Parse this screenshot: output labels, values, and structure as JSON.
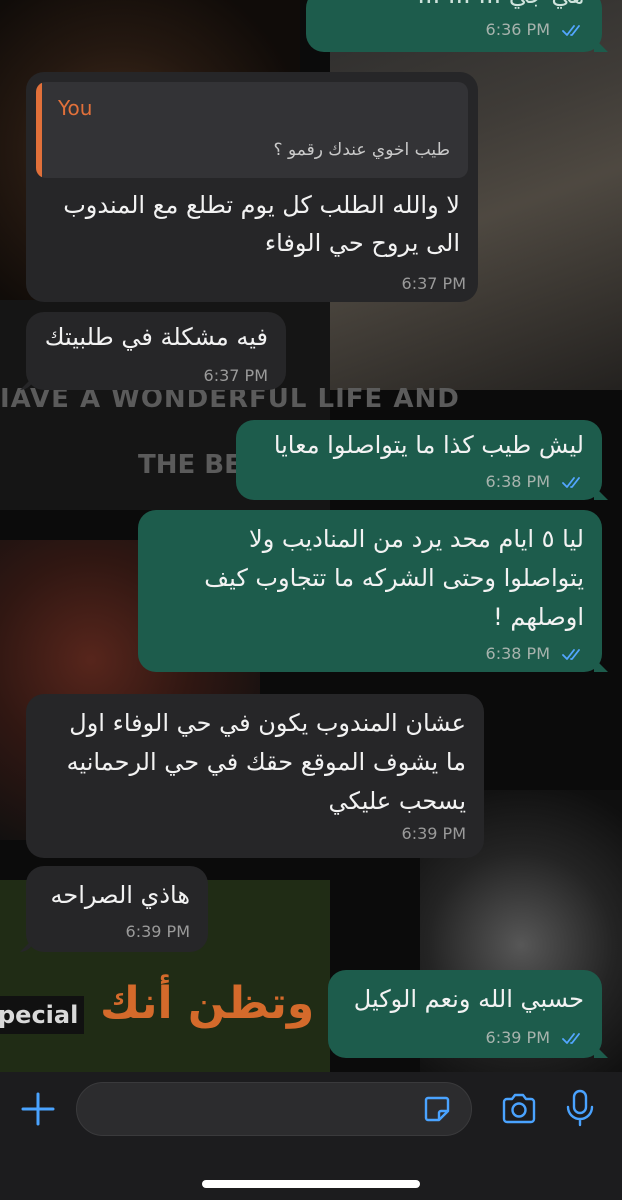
{
  "messages": [
    {
      "id": "m0",
      "direction": "outgoing",
      "lines": [
        "هي جي ... ... ..."
      ],
      "time": "6:36 PM",
      "read": true
    },
    {
      "id": "m1",
      "direction": "incoming",
      "reply_to": {
        "sender": "You",
        "text": "طيب اخوي عندك رقمو ؟"
      },
      "lines": [
        "لا والله الطلب كل يوم تطلع مع المندوب",
        "الى يروح حي الوفاء"
      ],
      "time": "6:37 PM"
    },
    {
      "id": "m2",
      "direction": "incoming",
      "lines": [
        "فيه مشكلة في طلبيتك"
      ],
      "time": "6:37 PM"
    },
    {
      "id": "m3",
      "direction": "outgoing",
      "lines": [
        "ليش طيب كذا ما يتواصلوا معايا"
      ],
      "time": "6:38 PM",
      "read": true
    },
    {
      "id": "m4",
      "direction": "outgoing",
      "lines": [
        "ليا ٥ ايام محد يرد من المناديب ولا",
        "يتواصلوا وحتى الشركه ما تتجاوب كيف",
        "اوصلهم !"
      ],
      "time": "6:38 PM",
      "read": true
    },
    {
      "id": "m5",
      "direction": "incoming",
      "lines": [
        "عشان المندوب يكون في حي الوفاء اول",
        "ما يشوف الموقع حقك في حي الرحمانيه",
        "يسحب عليكي"
      ],
      "time": "6:39 PM"
    },
    {
      "id": "m6",
      "direction": "incoming",
      "lines": [
        "هاذي الصراحه"
      ],
      "time": "6:39 PM"
    },
    {
      "id": "m7",
      "direction": "outgoing",
      "lines": [
        "حسبي الله ونعم الوكيل"
      ],
      "time": "6:39 PM",
      "read": true
    }
  ],
  "wallpaper": {
    "text1": "IAVE A WONDERFUL LIFE AND",
    "text2": "THE BEST",
    "special": "pecial",
    "arabic": "وتظن أنك"
  },
  "composer": {
    "value": "",
    "placeholder": ""
  },
  "icons": {
    "attach": "plus-icon",
    "sticker": "sticker-icon",
    "camera": "camera-icon",
    "mic": "microphone-icon",
    "read": "double-check-icon"
  },
  "colors": {
    "incoming_bubble": "#262628",
    "outgoing_bubble": "#1d5c4c",
    "read_ticks": "#53a6ff",
    "accent": "#4aa3ff",
    "quote_name": "#e1703a"
  }
}
